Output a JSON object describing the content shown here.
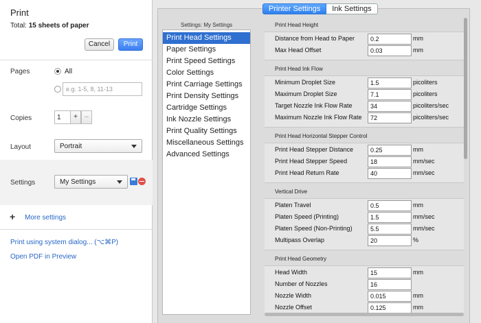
{
  "print_panel": {
    "title": "Print",
    "total_label": "Total: ",
    "total_value": "15 sheets of paper",
    "cancel_label": "Cancel",
    "print_label": "Print",
    "pages_label": "Pages",
    "pages_all": "All",
    "pages_placeholder": "e.g. 1-5, 8, 11-13",
    "copies_label": "Copies",
    "copies_value": "1",
    "copies_plus": "+",
    "copies_minus": "–",
    "layout_label": "Layout",
    "layout_value": "Portrait",
    "settings_label": "Settings",
    "settings_value": "My Settings",
    "more_settings": "More settings",
    "system_dialog": "Print using system dialog... (⌥⌘P)",
    "open_pdf": "Open PDF in Preview"
  },
  "dialog": {
    "tabs": [
      "Printer Settings",
      "Ink Settings"
    ],
    "settings_caption": "Settings: My Settings",
    "categories": [
      "Print Head Settings",
      "Paper Settings",
      "Print Speed Settings",
      "Color Settings",
      "Print Carriage Settings",
      "Print Density Settings",
      "Cartridge Settings",
      "Ink Nozzle Settings",
      "Print Quality Settings",
      "Miscellaneous Settings",
      "Advanced Settings"
    ],
    "groups": [
      {
        "title": "Print Head Height",
        "rows": [
          {
            "label": "Distance from Head to Paper",
            "value": "0.2",
            "unit": "mm"
          },
          {
            "label": "Max Head Offset",
            "value": "0.03",
            "unit": "mm"
          }
        ]
      },
      {
        "title": "Print Head Ink Flow",
        "rows": [
          {
            "label": "Minimum Droplet Size",
            "value": "1.5",
            "unit": "picoliters"
          },
          {
            "label": "Maximum Droplet Size",
            "value": "7.1",
            "unit": "picoliters"
          },
          {
            "label": "Target Nozzle Ink Flow Rate",
            "value": "34",
            "unit": "picoliters/sec"
          },
          {
            "label": "Maximum Nozzle Ink Flow Rate",
            "value": "72",
            "unit": "picoliters/sec"
          }
        ]
      },
      {
        "title": "Print Head Horizontal Stepper Control",
        "rows": [
          {
            "label": "Print Head Stepper Distance",
            "value": "0.25",
            "unit": "mm"
          },
          {
            "label": "Print Head Stepper Speed",
            "value": "18",
            "unit": "mm/sec"
          },
          {
            "label": "Print Head Return Rate",
            "value": "40",
            "unit": "mm/sec"
          }
        ]
      },
      {
        "title": "Vertical Drive",
        "rows": [
          {
            "label": "Platen Travel",
            "value": "0.5",
            "unit": "mm"
          },
          {
            "label": "Platen Speed (Printing)",
            "value": "1.5",
            "unit": "mm/sec"
          },
          {
            "label": "Platen Speed (Non-Printing)",
            "value": "5.5",
            "unit": "mm/sec"
          },
          {
            "label": "Multipass Overlap",
            "value": "20",
            "unit": "%"
          }
        ]
      },
      {
        "title": "Print Head Geometry",
        "rows": [
          {
            "label": "Head Width",
            "value": "15",
            "unit": "mm"
          },
          {
            "label": "Number of Nozzles",
            "value": "16",
            "unit": ""
          },
          {
            "label": "Nozzle Width",
            "value": "0.015",
            "unit": "mm"
          },
          {
            "label": "Nozzle Offset",
            "value": "0.125",
            "unit": "mm"
          }
        ]
      }
    ]
  },
  "colors": {
    "accent": "#2f6fcf",
    "print_button": "#3b7ef0",
    "link": "#2766c6"
  }
}
